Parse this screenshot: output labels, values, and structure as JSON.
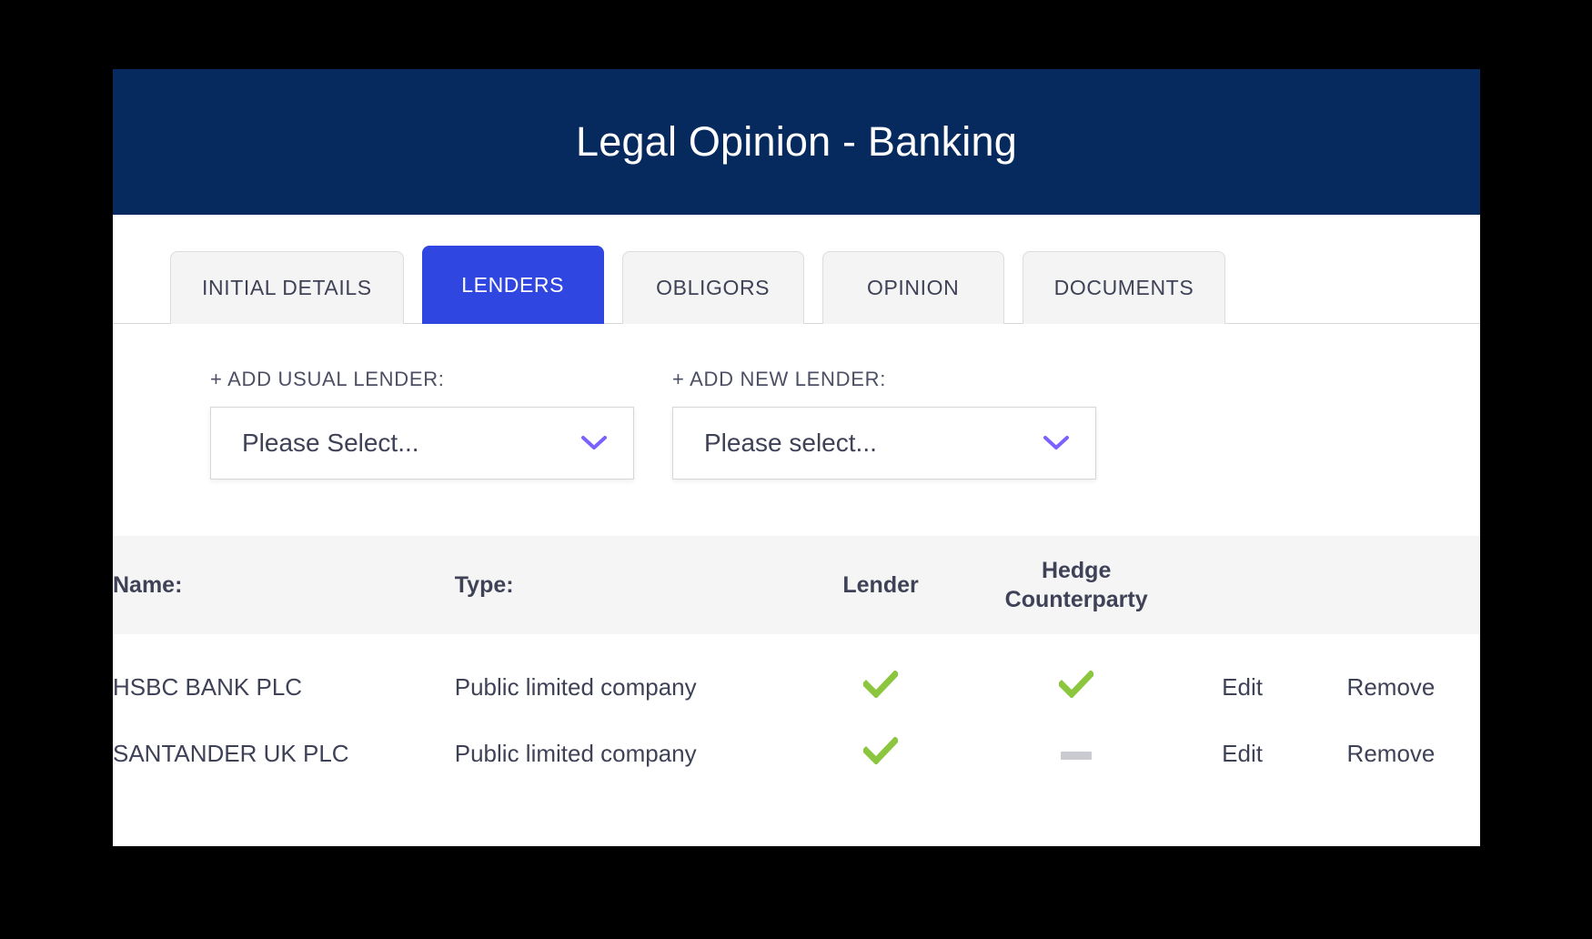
{
  "header": {
    "title": "Legal Opinion - Banking",
    "bg_color": "#062a5e"
  },
  "tabs": [
    {
      "label": "INITIAL DETAILS",
      "active": false
    },
    {
      "label": "LENDERS",
      "active": true
    },
    {
      "label": "OBLIGORS",
      "active": false
    },
    {
      "label": "OPINION",
      "active": false
    },
    {
      "label": "DOCUMENTS",
      "active": false
    }
  ],
  "tab_active_color": "#2f46e0",
  "selectors": [
    {
      "label": "+ ADD USUAL LENDER:",
      "value": "Please Select...",
      "icon": "chevron-down-icon",
      "icon_color": "#7b61ff"
    },
    {
      "label": "+ ADD NEW LENDER:",
      "value": "Please select...",
      "icon": "chevron-down-icon",
      "icon_color": "#7b61ff"
    }
  ],
  "table": {
    "headers": {
      "name": "Name:",
      "type": "Type:",
      "lender": "Lender",
      "hedge_line1": "Hedge",
      "hedge_line2": "Counterparty",
      "edit": "",
      "remove": ""
    },
    "check_color": "#8cc63e",
    "dash_color": "#c9cbd0",
    "rows": [
      {
        "name": "HSBC BANK PLC",
        "type": "Public limited company",
        "lender": "check",
        "hedge": "check",
        "edit_label": "Edit",
        "remove_label": "Remove"
      },
      {
        "name": "SANTANDER UK PLC",
        "type": "Public limited company",
        "lender": "check",
        "hedge": "dash",
        "edit_label": "Edit",
        "remove_label": "Remove"
      }
    ]
  }
}
